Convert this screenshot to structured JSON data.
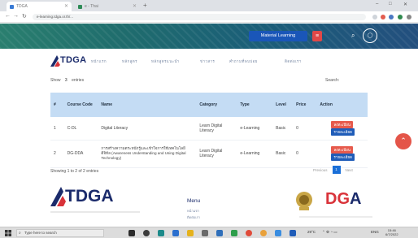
{
  "browser": {
    "tabs": [
      {
        "label": "TDGA",
        "active": true
      },
      {
        "label": "e - Thai",
        "active": false
      }
    ],
    "new_tab": "+",
    "win_controls": [
      "–",
      "□",
      "✕"
    ],
    "nav": [
      "←",
      "→",
      "↻"
    ],
    "url": "e-learning.tdga.or.th/..."
  },
  "banner": {
    "material_button": "Material Learning",
    "red_button": "≡",
    "search_icon": "⌕",
    "user_icon": "◯"
  },
  "site": {
    "logo": "TDGA",
    "nav_links": [
      "หน้าแรก",
      "หลักสูตร",
      "หลักสูตรแนะนำ",
      "ข่าวสาร",
      "คำถามที่พบบ่อย",
      "ติดต่อเรา"
    ]
  },
  "table": {
    "show_label": "Show",
    "show_count": "3",
    "entries_label": "entries",
    "search_label": "Search:",
    "headers": [
      "#",
      "Course Code",
      "Name",
      "Category",
      "Type",
      "Level",
      "Price",
      "Action"
    ],
    "rows": [
      {
        "num": "1",
        "code": "C-DL",
        "name": "Digital Literacy",
        "category": "Learn Digital Literacy",
        "type": "e-Learning",
        "level": "Basic",
        "price": "0",
        "register": "ลงทะเบียน",
        "detail": "รายละเอียด"
      },
      {
        "num": "2",
        "code": "DG-DDA",
        "name": "การสร้างความตระหนักรู้และเข้าใจการใช้เทคโนโลยีดิจิทัล (Awareness Understanding and Using Digital Technology)",
        "category": "Learn Digital Literacy",
        "type": "e-Learning",
        "level": "Basic",
        "price": "0",
        "register": "ลงทะเบียน",
        "detail": "รายละเอียด"
      }
    ],
    "showing_text": "Showing 1 to 2 of 2 entries",
    "pager": {
      "prev": "Previous",
      "current": "1",
      "next": "Next"
    }
  },
  "scroll_top_icon": "⌃",
  "footer": {
    "logo": "TDGA",
    "menu_title": "Menu",
    "menu_items": [
      "หน้าแรก",
      "ติดต่อเรา"
    ],
    "dga_logo_a": "DG",
    "dga_logo_b": "A"
  },
  "taskbar": {
    "search_placeholder": "Type here to search",
    "tray_text": "29°C",
    "lang": "ENG",
    "time": "15:46",
    "date": "6/7/2022"
  },
  "colors": {
    "banner_start": "#2a7f6f",
    "banner_end": "#234f7e",
    "header_row": "#c4dcf4",
    "primary": "#1b2b6b",
    "accent_red": "#e45549",
    "button_blue": "#1f5cb8"
  }
}
